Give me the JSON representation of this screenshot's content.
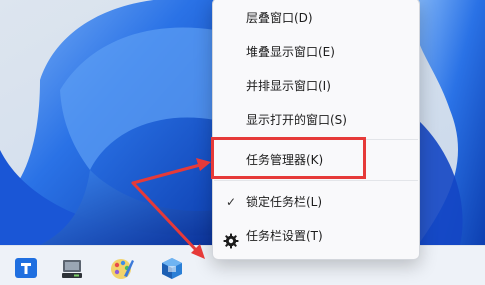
{
  "context_menu": {
    "items": [
      {
        "label": "层叠窗口(D)"
      },
      {
        "label": "堆叠显示窗口(E)"
      },
      {
        "label": "并排显示窗口(I)"
      },
      {
        "label": "显示打开的窗口(S)"
      },
      {
        "label": "任务管理器(K)"
      },
      {
        "label": "锁定任务栏(L)",
        "checked": true,
        "check_glyph": "✓"
      },
      {
        "label": "任务栏设置(T)",
        "icon": "gear-icon"
      }
    ]
  },
  "taskbar": {
    "icons": [
      "editor-app-icon",
      "computer-app-icon",
      "paint-app-icon",
      "package-app-icon"
    ]
  },
  "annotation": {
    "color": "#e63a39"
  }
}
